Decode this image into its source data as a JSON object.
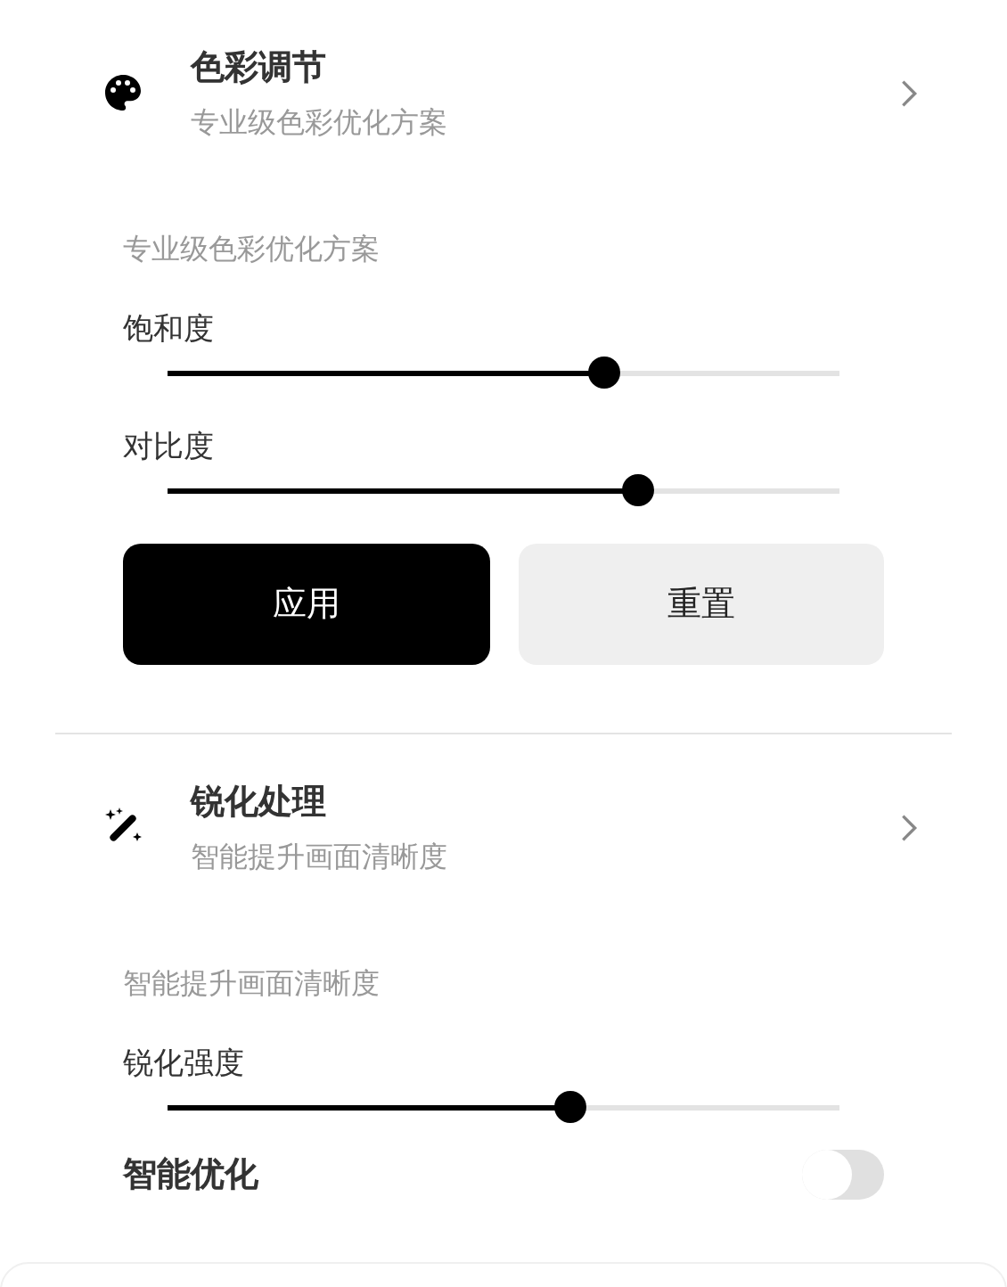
{
  "sections": [
    {
      "title": "色彩调节",
      "subtitle": "专业级色彩优化方案",
      "expanded": true,
      "panel_label": "专业级色彩优化方案",
      "controls": [
        {
          "kind": "slider",
          "label": "饱和度",
          "level": 0.65
        },
        {
          "kind": "slider",
          "label": "对比度",
          "level": 0.7
        },
        {
          "kind": "buttons",
          "buttons": [
            "应用",
            "重置"
          ]
        }
      ]
    },
    {
      "title": "锐化处理",
      "subtitle": "智能提升画面清晰度",
      "expanded": true,
      "panel_label": "智能提升画面清晰度",
      "controls": [
        {
          "kind": "slider",
          "label": "锐化强度",
          "level": 0.6
        },
        {
          "kind": "toggle",
          "label": "智能优化",
          "on": false
        }
      ]
    }
  ]
}
